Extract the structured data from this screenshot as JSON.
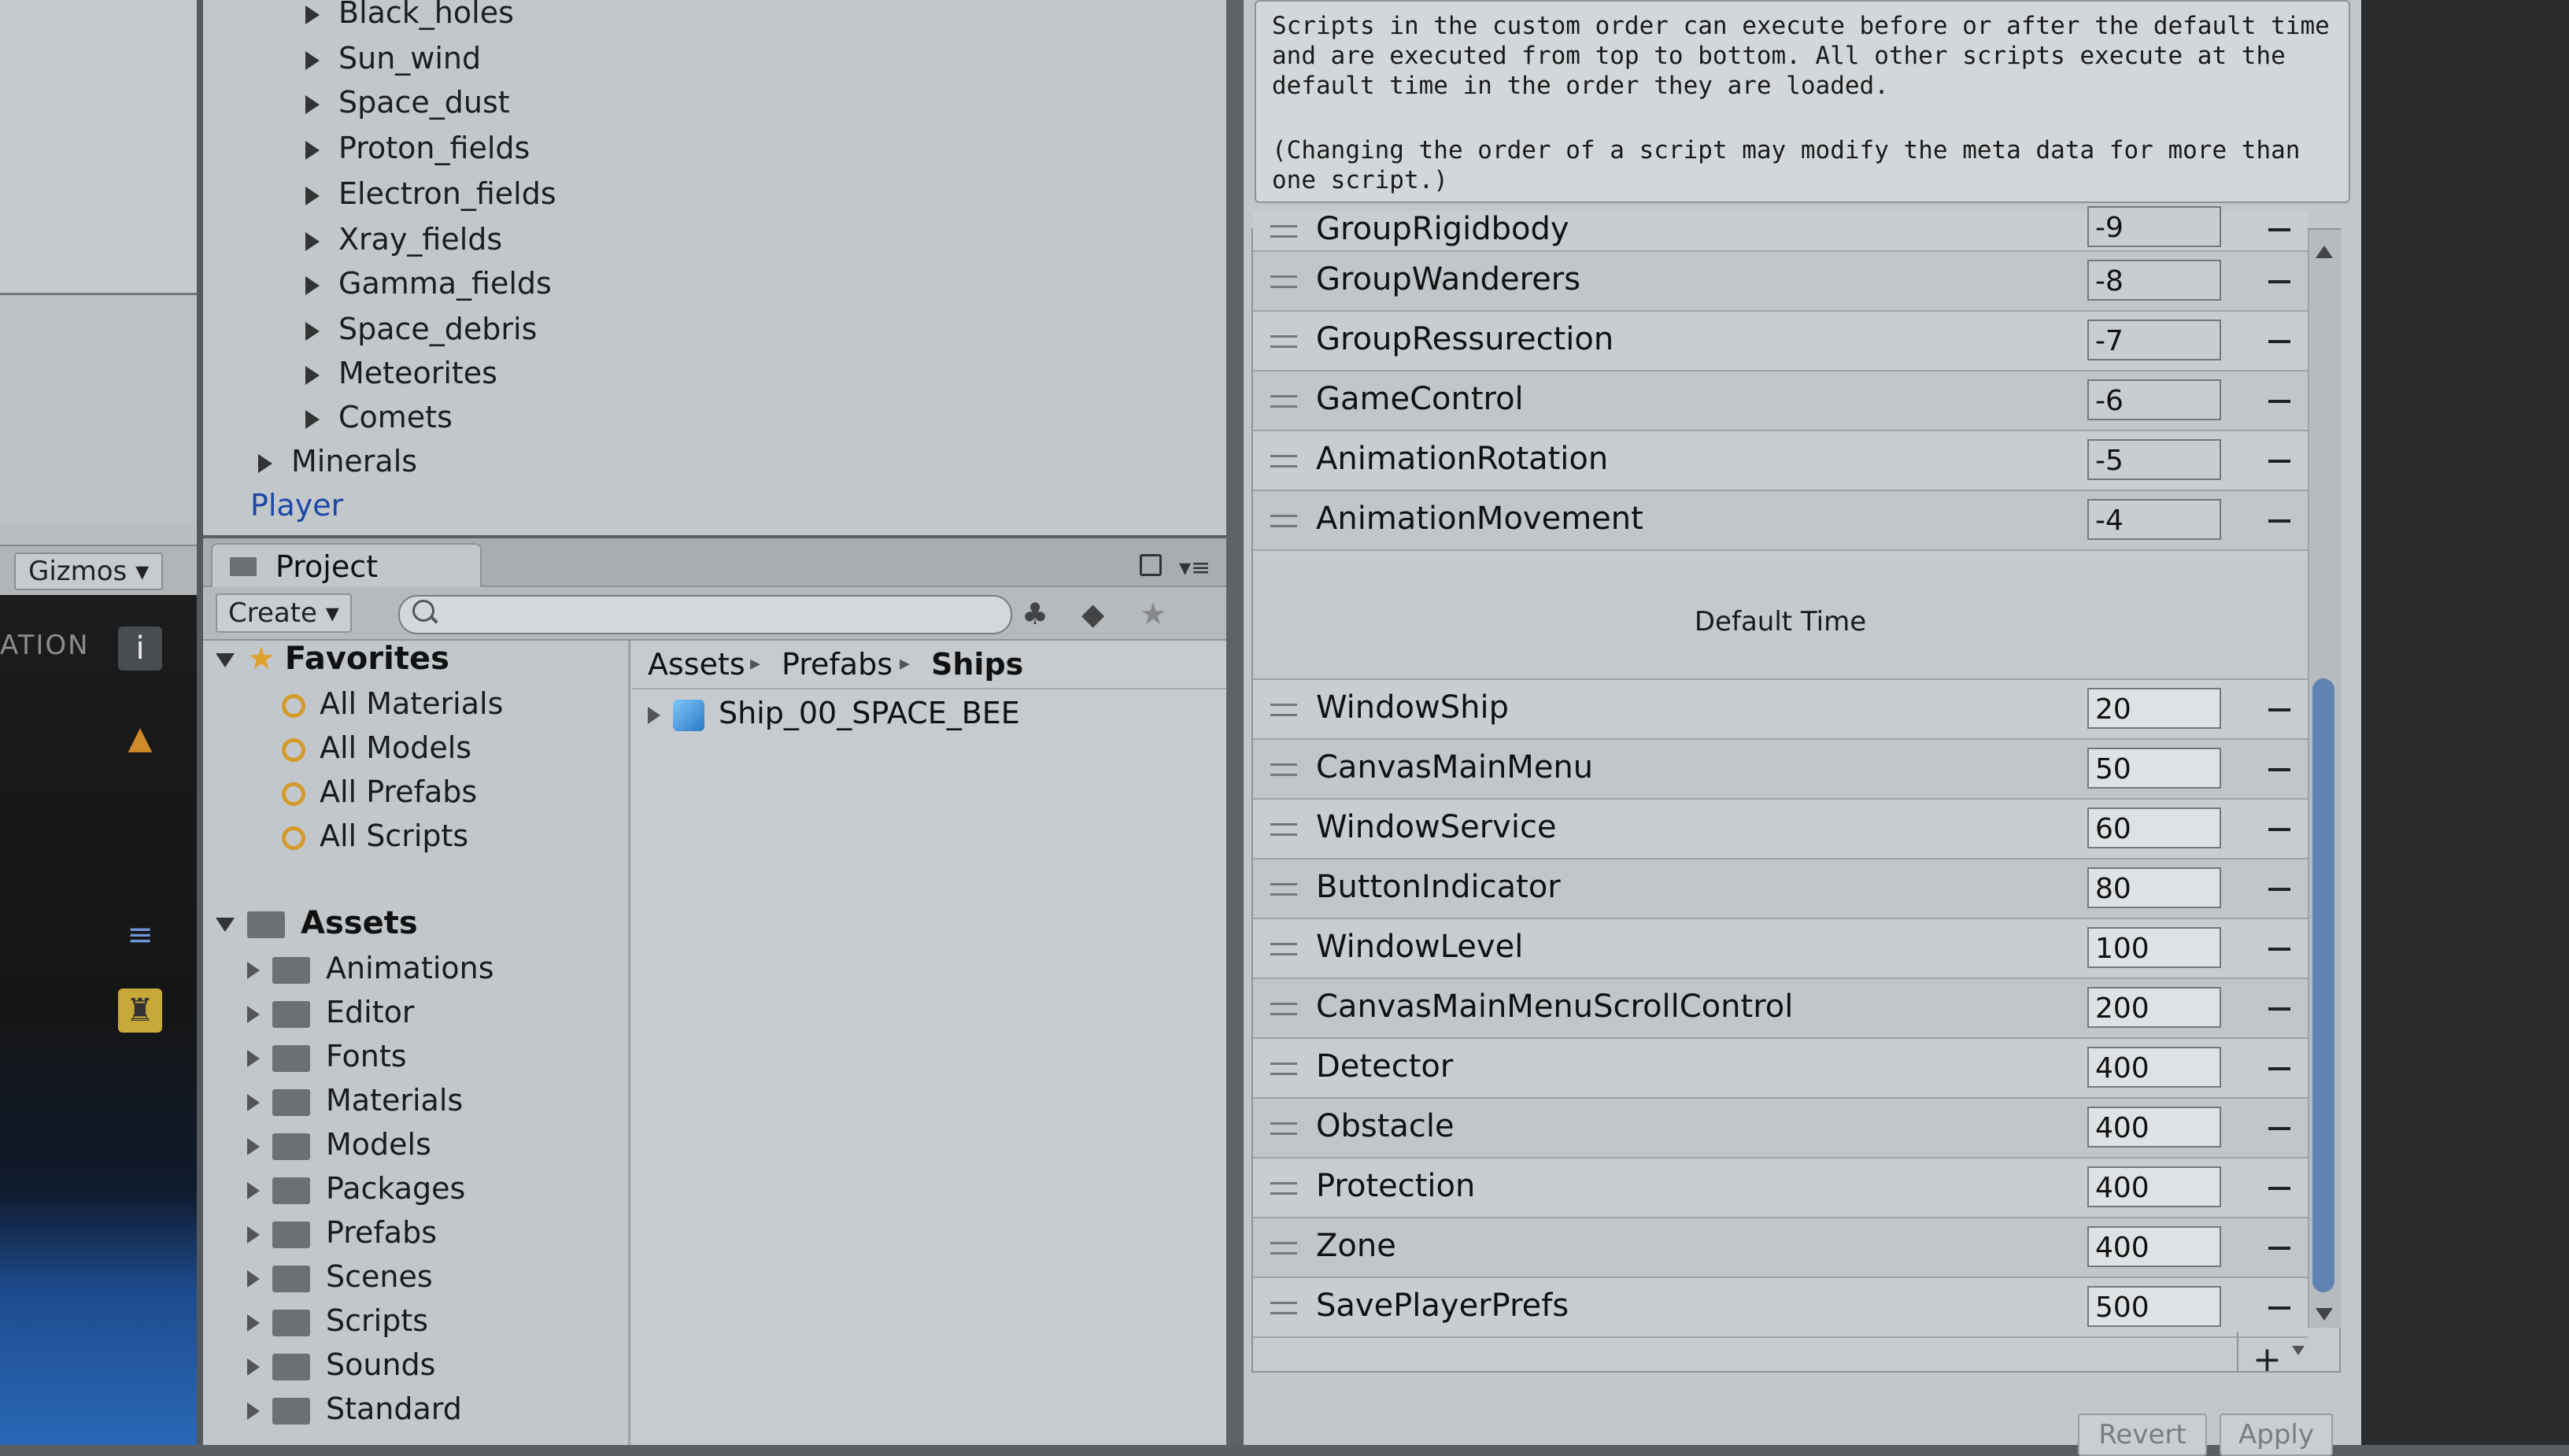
{
  "scene": {
    "gizmos_label": "Gizmos",
    "ation_label": "ATION"
  },
  "hierarchy": {
    "items": [
      {
        "label": "Black_holes"
      },
      {
        "label": "Sun_wind"
      },
      {
        "label": "Space_dust"
      },
      {
        "label": "Proton_fields"
      },
      {
        "label": "Electron_fields"
      },
      {
        "label": "Xray_fields"
      },
      {
        "label": "Gamma_fields"
      },
      {
        "label": "Space_debris"
      },
      {
        "label": "Meteorites"
      },
      {
        "label": "Comets"
      }
    ],
    "minerals": "Minerals",
    "player": "Player"
  },
  "project": {
    "tab_label": "Project",
    "create_label": "Create",
    "search_placeholder": "",
    "favorites": {
      "header": "Favorites",
      "items": [
        "All Materials",
        "All Models",
        "All Prefabs",
        "All Scripts"
      ]
    },
    "assets": {
      "header": "Assets",
      "folders": [
        "Animations",
        "Editor",
        "Fonts",
        "Materials",
        "Models",
        "Packages",
        "Prefabs",
        "Scenes",
        "Scripts",
        "Sounds",
        "Standard"
      ]
    },
    "breadcrumb": [
      "Assets",
      "Prefabs",
      "Ships"
    ],
    "contents": [
      "Ship_00_SPACE_BEE"
    ]
  },
  "inspector": {
    "help_line1": "Scripts in the custom order can execute before or after the default time and are executed from top to bottom. All other scripts execute at the default time in the order they are loaded.",
    "help_line2": "(Changing the order of a script may modify the meta data for more than one script.)",
    "partial_row": {
      "name": "GroupRigidbody",
      "value": "-9"
    },
    "before_default": [
      {
        "name": "GroupWanderers",
        "value": "-8"
      },
      {
        "name": "GroupRessurection",
        "value": "-7"
      },
      {
        "name": "GameControl",
        "value": "-6"
      },
      {
        "name": "AnimationRotation",
        "value": "-5"
      },
      {
        "name": "AnimationMovement",
        "value": "-4"
      }
    ],
    "default_time_label": "Default Time",
    "after_default": [
      {
        "name": "WindowShip",
        "value": "20"
      },
      {
        "name": "CanvasMainMenu",
        "value": "50"
      },
      {
        "name": "WindowService",
        "value": "60"
      },
      {
        "name": "ButtonIndicator",
        "value": "80"
      },
      {
        "name": "WindowLevel",
        "value": "100"
      },
      {
        "name": "CanvasMainMenuScrollControl",
        "value": "200"
      },
      {
        "name": "Detector",
        "value": "400"
      },
      {
        "name": "Obstacle",
        "value": "400"
      },
      {
        "name": "Protection",
        "value": "400"
      },
      {
        "name": "Zone",
        "value": "400"
      },
      {
        "name": "SavePlayerPrefs",
        "value": "500"
      }
    ],
    "add_label": "+",
    "revert_label": "Revert",
    "apply_label": "Apply"
  }
}
